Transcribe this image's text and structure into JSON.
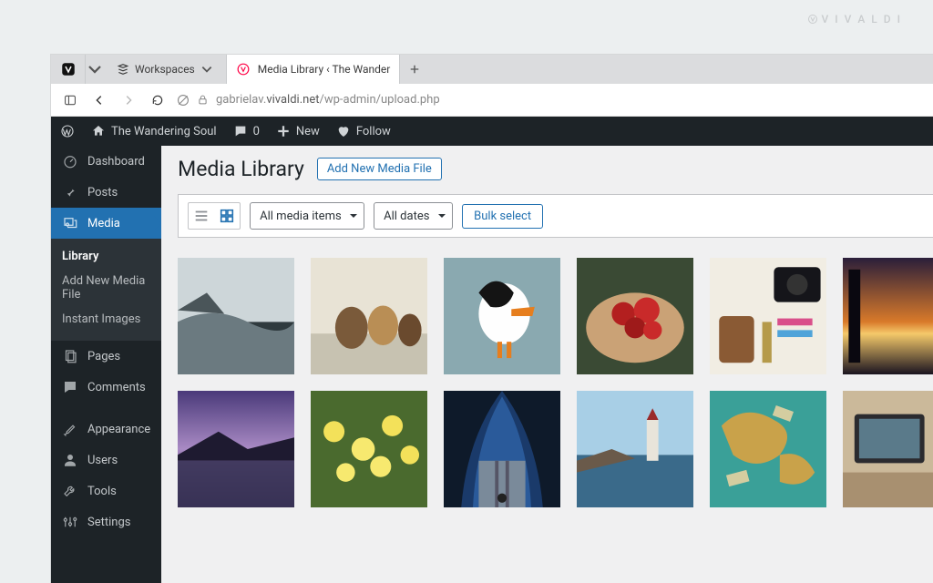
{
  "watermark": "V I V A L D I",
  "browser": {
    "workspaces_label": "Workspaces",
    "tab_title": "Media Library ‹ The Wander",
    "url_prefix": "gabrielav.",
    "url_host": "vivaldi.net",
    "url_path": "/wp-admin/upload.php"
  },
  "wp_bar": {
    "site_title": "The Wandering Soul",
    "comments_count": "0",
    "new_label": "New",
    "follow_label": "Follow"
  },
  "sidebar": {
    "items": [
      {
        "label": "Dashboard"
      },
      {
        "label": "Posts"
      },
      {
        "label": "Media"
      },
      {
        "label": "Pages"
      },
      {
        "label": "Comments"
      },
      {
        "label": "Appearance"
      },
      {
        "label": "Users"
      },
      {
        "label": "Tools"
      },
      {
        "label": "Settings"
      }
    ],
    "sub_media": [
      {
        "label": "Library",
        "active": true
      },
      {
        "label": "Add New Media File"
      },
      {
        "label": "Instant Images"
      }
    ]
  },
  "main": {
    "heading": "Media Library",
    "add_new": "Add New Media File",
    "filter_type": "All media items",
    "filter_date": "All dates",
    "bulk_select": "Bulk select"
  },
  "thumbs": [
    {
      "name": "beach-cliffs"
    },
    {
      "name": "horses-winter"
    },
    {
      "name": "puffin-bird"
    },
    {
      "name": "hand-tomatoes"
    },
    {
      "name": "desk-camera-map"
    },
    {
      "name": "sunset-horizon"
    },
    {
      "name": "purple-lake"
    },
    {
      "name": "daffodils-field"
    },
    {
      "name": "subway-tunnel"
    },
    {
      "name": "lighthouse-shore"
    },
    {
      "name": "world-map-cash"
    },
    {
      "name": "laptop-van"
    }
  ]
}
